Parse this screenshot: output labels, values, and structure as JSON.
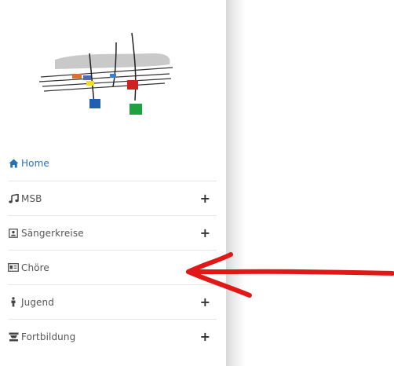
{
  "nav": {
    "items": [
      {
        "label": "Home",
        "icon": "home-icon",
        "expandable": false,
        "active": true
      },
      {
        "label": "MSB",
        "icon": "music-note-icon",
        "expandable": true,
        "active": false
      },
      {
        "label": "Sängerkreise",
        "icon": "address-book-icon",
        "expandable": true,
        "active": false
      },
      {
        "label": "Chöre",
        "icon": "id-card-icon",
        "expandable": false,
        "active": false
      },
      {
        "label": "Jugend",
        "icon": "person-icon",
        "expandable": true,
        "active": false
      },
      {
        "label": "Fortbildung",
        "icon": "graduation-cap-icon",
        "expandable": true,
        "active": false
      }
    ],
    "expand_symbol": "+"
  },
  "colors": {
    "active": "#2a6fb5",
    "text": "#555555",
    "annotation_arrow": "#e01818"
  }
}
